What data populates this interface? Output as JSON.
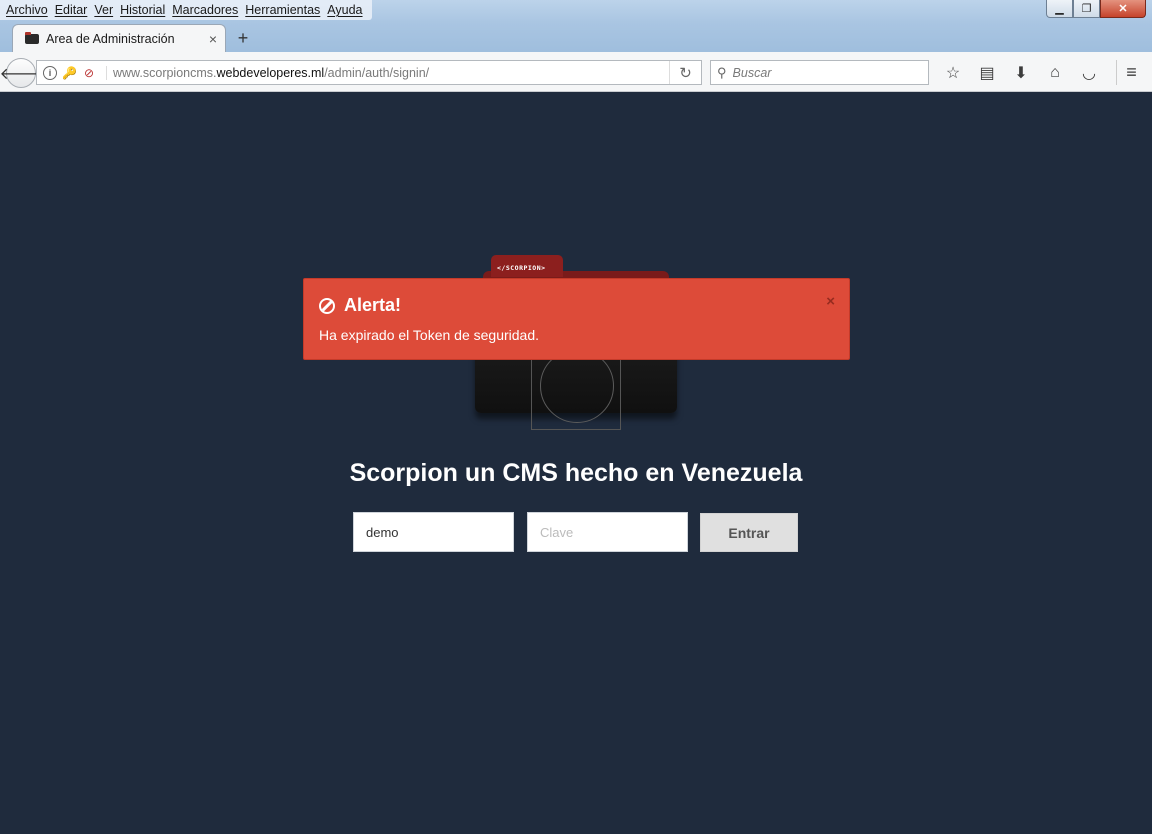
{
  "menu": [
    "Archivo",
    "Editar",
    "Ver",
    "Historial",
    "Marcadores",
    "Herramientas",
    "Ayuda"
  ],
  "tab": {
    "title": "Area de Administración",
    "close": "×",
    "new_tab": "+"
  },
  "navbar": {
    "url_domain_prefix": "www.scorpioncms.",
    "url_domain_main": "webdeveloperes.ml",
    "url_path": "/admin/auth/signin/",
    "search_placeholder": "Buscar"
  },
  "icons": {
    "back": "back-arrow-icon",
    "info": "info-icon",
    "key": "key-icon",
    "insecure": "insecure-icon",
    "reload": "reload-icon",
    "search": "search-icon",
    "bookmark": "star-icon",
    "reading_list": "clipboard-icon",
    "downloads": "download-icon",
    "home": "home-icon",
    "pocket": "pocket-icon",
    "menu": "hamburger-icon"
  },
  "logo": {
    "tab_text": "</SCORPION>"
  },
  "alert": {
    "title": "Alerta!",
    "message": "Ha expirado el Token de seguridad.",
    "close": "×",
    "color": "#dd4b39"
  },
  "page": {
    "headline": "Scorpion un CMS hecho en Venezuela",
    "background": "#1f2b3d"
  },
  "form": {
    "username_value": "demo",
    "password_placeholder": "Clave",
    "submit_label": "Entrar"
  }
}
